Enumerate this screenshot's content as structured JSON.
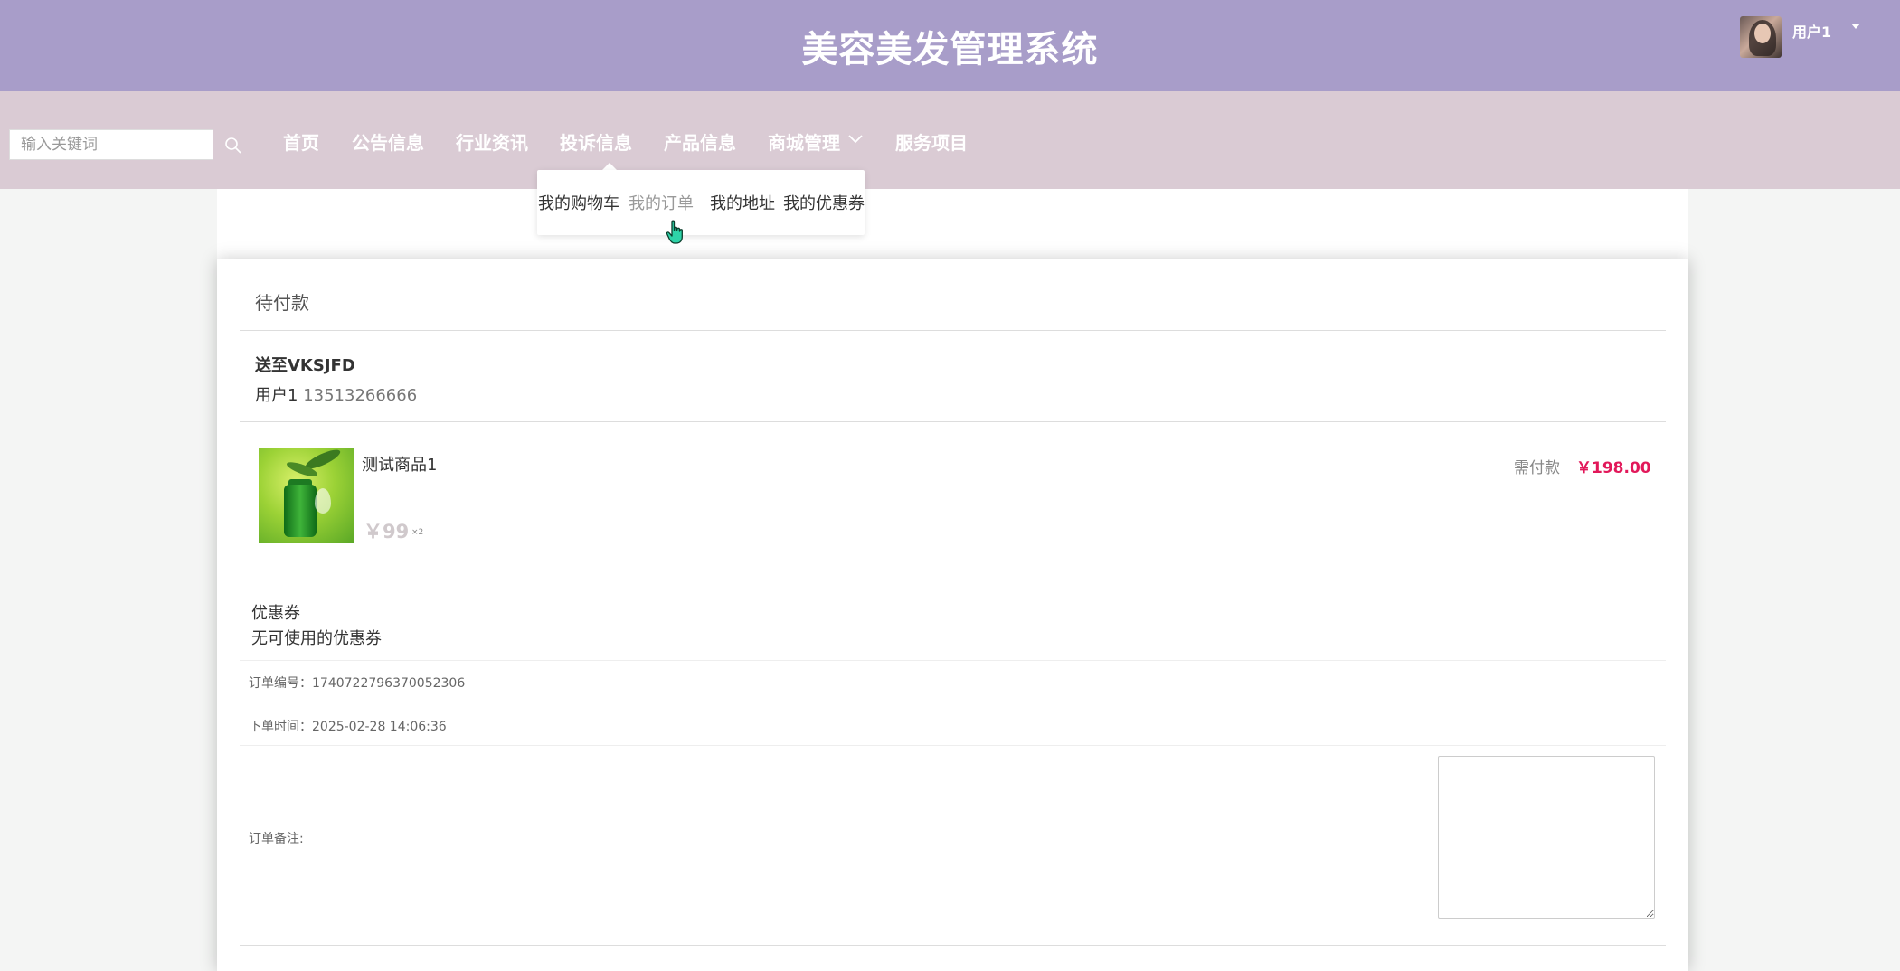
{
  "header": {
    "site_title": "美容美发管理系统",
    "user_name": "用户1"
  },
  "search": {
    "placeholder": "输入关键词"
  },
  "nav": {
    "items": [
      "首页",
      "公告信息",
      "行业资讯",
      "投诉信息",
      "产品信息",
      "商城管理",
      "服务项目"
    ]
  },
  "dropdown": {
    "items": [
      "我的购物车",
      "我的订单",
      "我的地址",
      "我的优惠券"
    ],
    "active_index": 1
  },
  "order": {
    "status": "待付款",
    "ship_to": "送至VKSJFD",
    "recipient_name": "用户1",
    "recipient_phone": "13513266666",
    "product_name": "测试商品1",
    "product_price": "￥99",
    "product_qty": "×2",
    "pay_label": "需付款",
    "pay_amount": "￥198.00",
    "coupon_label": "优惠券",
    "coupon_value": "无可使用的优惠券",
    "order_no_label": "订单编号：",
    "order_no": "1740722796370052306",
    "order_time_label": "下单时间：",
    "order_time": "2025-02-28 14:06:36",
    "remark_label": "订单备注:"
  },
  "colors": {
    "header_bg": "#a89dc9",
    "nav_bg": "#dacbd4",
    "price_accent": "#e2185a"
  }
}
